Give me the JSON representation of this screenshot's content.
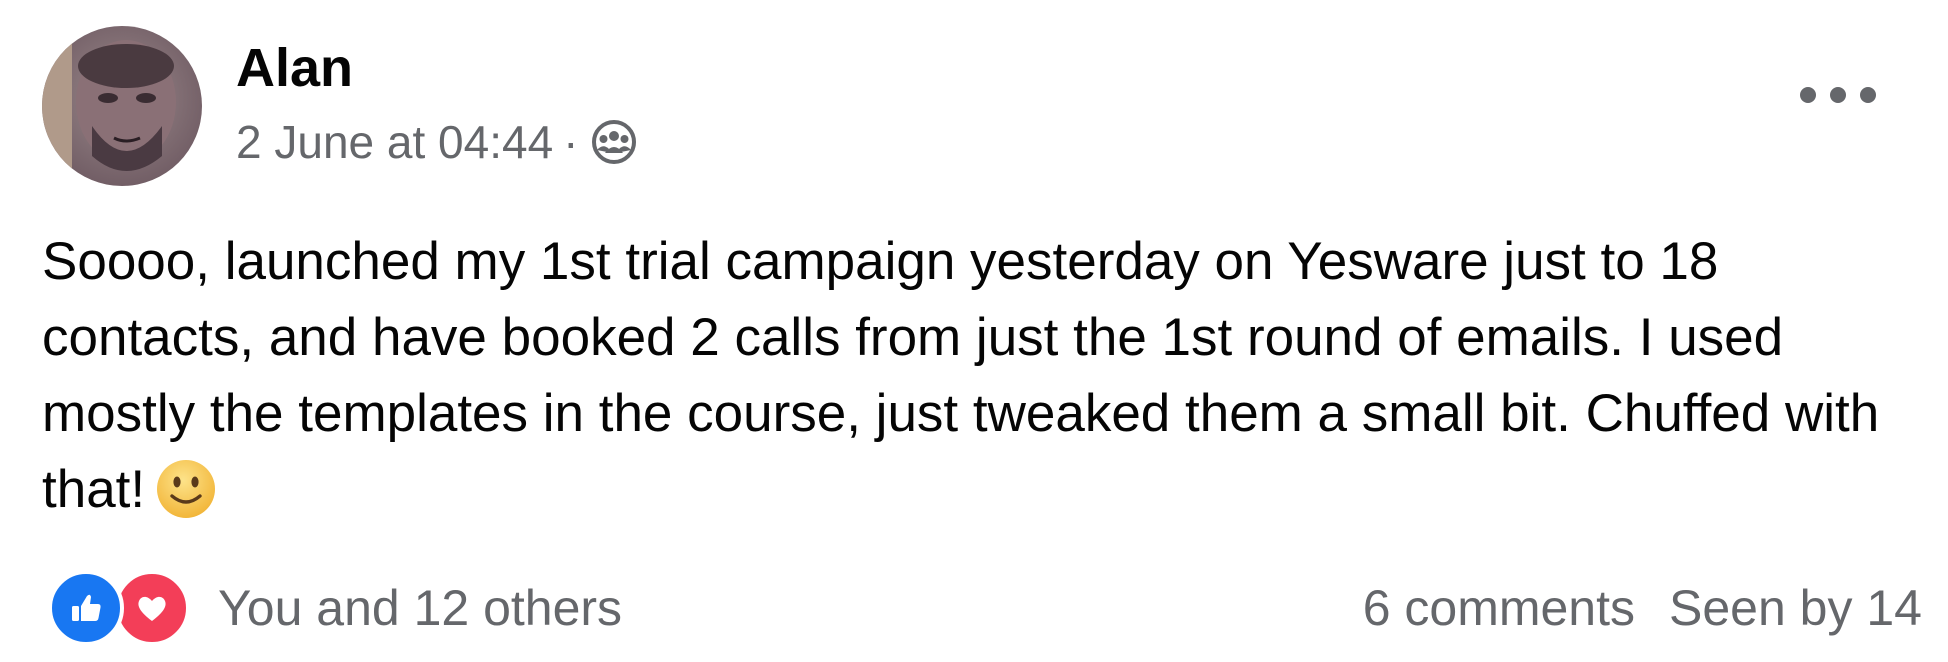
{
  "post": {
    "author": "Alan",
    "timestamp": "2 June at 04:44",
    "separator": "·",
    "audience_icon": "group-audience-icon",
    "more_icon": "more-options-icon",
    "body": "Soooo, launched my 1st trial campaign yesterday on Yesware just to 18 contacts, and have booked 2 calls from just the 1st round of emails. I used mostly the templates in the course, just tweaked them a small bit. Chuffed with that!",
    "emoji": "slightly-smiling-face-icon"
  },
  "footer": {
    "reaction_icons": [
      "like-icon",
      "love-icon"
    ],
    "reaction_text": "You and 12 others",
    "comments": "6 comments",
    "seen": "Seen by 14"
  },
  "colors": {
    "text": "#050505",
    "secondary_text": "#65676b",
    "like_blue": "#1877f2",
    "love_red": "#f33e58",
    "emoji_yellow": "#f7c443"
  }
}
